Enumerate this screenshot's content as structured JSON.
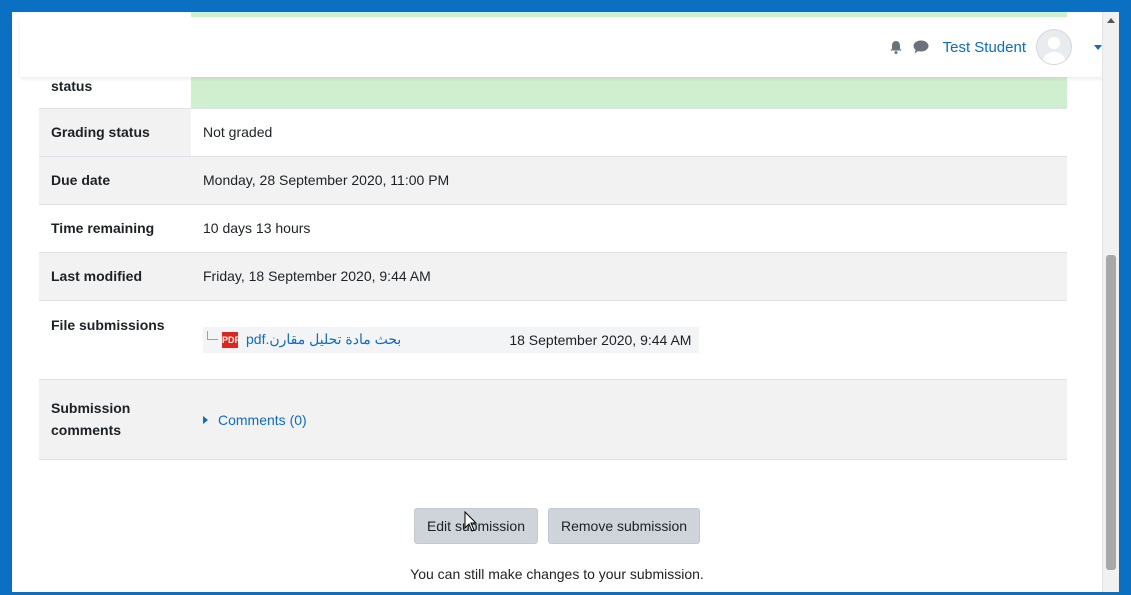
{
  "header": {
    "user_name": "Test Student",
    "icons": [
      "bell-icon",
      "chat-icon",
      "avatar",
      "chevron-down-icon"
    ]
  },
  "submission_status": {
    "rows": [
      {
        "label": "status",
        "value": ""
      },
      {
        "label": "Grading status",
        "value": "Not graded"
      },
      {
        "label": "Due date",
        "value": "Monday, 28 September 2020, 11:00 PM"
      },
      {
        "label": "Time remaining",
        "value": "10 days 13 hours"
      },
      {
        "label": "Last modified",
        "value": "Friday, 18 September 2020, 9:44 AM"
      },
      {
        "label": "File submissions",
        "file_name": "بحث مادة تحليل مقارن.pdf",
        "file_date": "18 September 2020, 9:44 AM"
      },
      {
        "label": "Submission comments",
        "comments_link": "Comments (0)"
      }
    ]
  },
  "actions": {
    "edit_label": "Edit submission",
    "remove_label": "Remove submission",
    "note": "You can still make changes to your submission."
  },
  "colors": {
    "accent": "#0f6cbf",
    "submitted_green": "#cfefcf",
    "frame_blue": "#0b6fc2"
  }
}
